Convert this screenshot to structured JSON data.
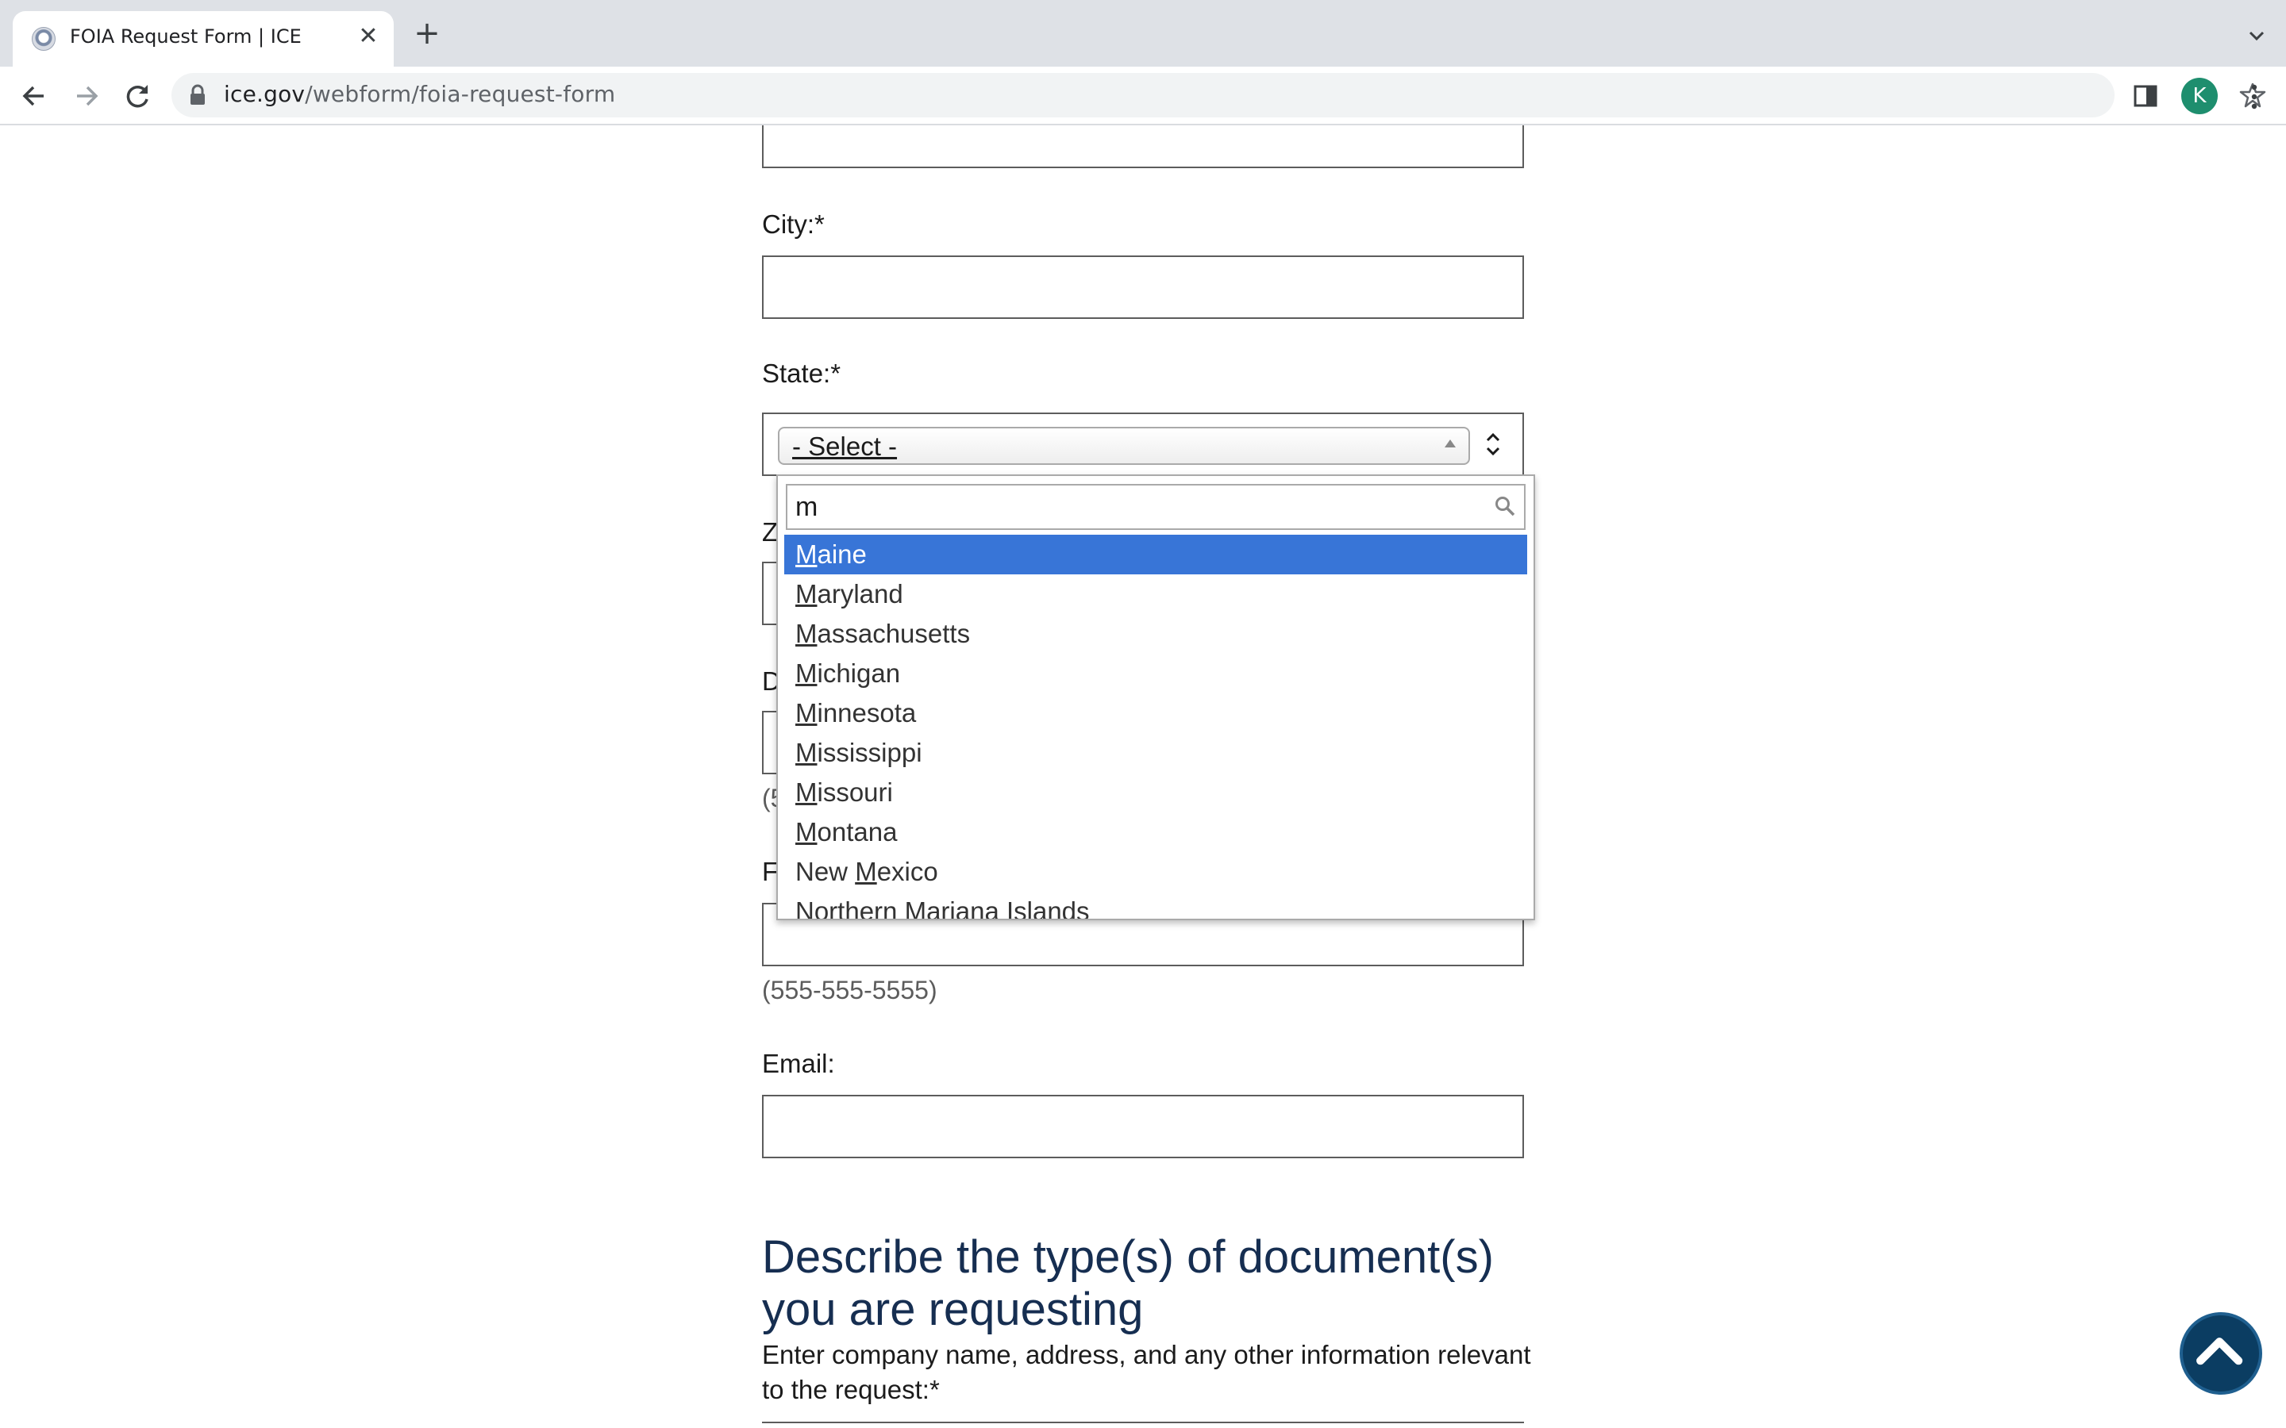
{
  "browser": {
    "tab_title": "FOIA Request Form | ICE",
    "tab_close_glyph": "✕",
    "new_tab_glyph": "+",
    "url_host": "ice.gov",
    "url_path": "/webform/foia-request-form",
    "avatar_letter": "K"
  },
  "form": {
    "city_label": "City:*",
    "state_label": "State:*",
    "state_selected": "- Select -",
    "zip_label_fragment": "Z",
    "daytime_label_fragment": "D",
    "daytime_hint_fragment": "(5",
    "fax_label_fragment": "F",
    "fax_hint": "(555-555-5555)",
    "email_label": "Email:"
  },
  "state_dropdown": {
    "search_value": "m",
    "options": [
      {
        "pre": "",
        "match": "M",
        "post": "aine"
      },
      {
        "pre": "",
        "match": "M",
        "post": "aryland"
      },
      {
        "pre": "",
        "match": "M",
        "post": "assachusetts"
      },
      {
        "pre": "",
        "match": "M",
        "post": "ichigan"
      },
      {
        "pre": "",
        "match": "M",
        "post": "innesota"
      },
      {
        "pre": "",
        "match": "M",
        "post": "ississippi"
      },
      {
        "pre": "",
        "match": "M",
        "post": "issouri"
      },
      {
        "pre": "",
        "match": "M",
        "post": "ontana"
      },
      {
        "pre": "New ",
        "match": "M",
        "post": "exico"
      },
      {
        "pre": "Northern ",
        "match": "M",
        "post": "ariana Islands"
      }
    ],
    "highlighted_index": 0
  },
  "section": {
    "heading": "Describe the type(s) of document(s) you are requesting",
    "instructions": "Enter company name, address, and any other information relevant to the request:*"
  },
  "colors": {
    "heading": "#162e51",
    "highlight": "#3875d7",
    "back_to_top": "#0b3d62"
  }
}
